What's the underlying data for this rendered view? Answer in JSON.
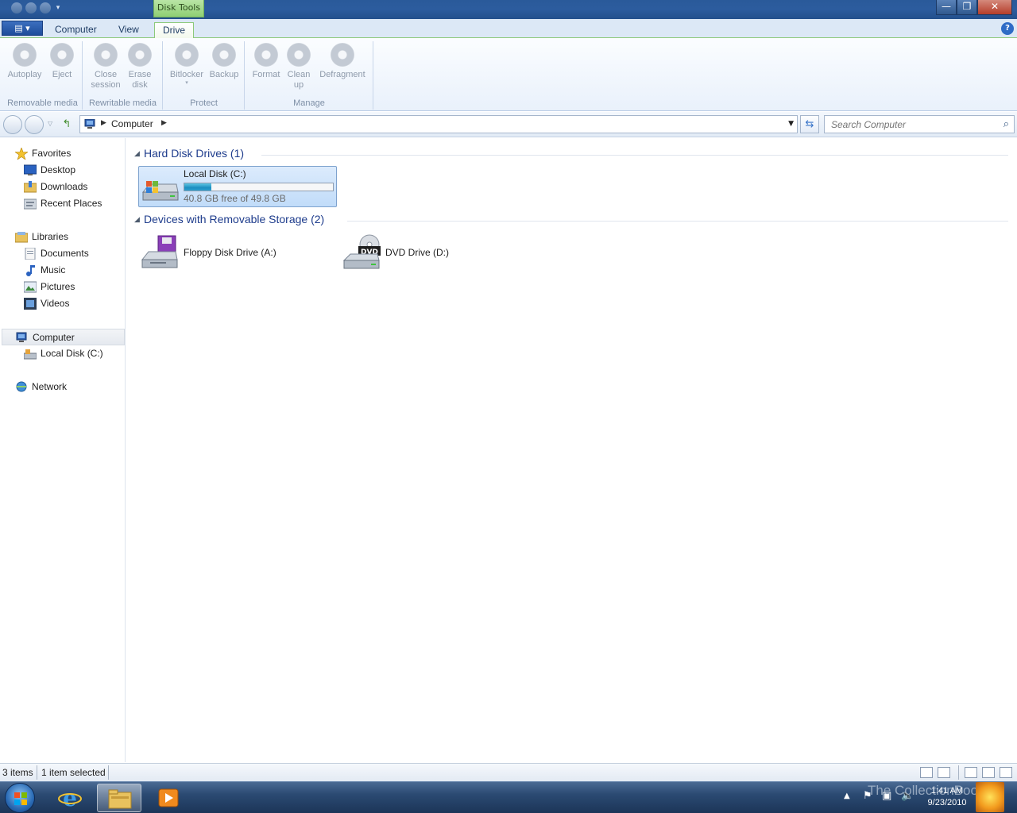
{
  "window": {
    "context_tab": "Disk Tools",
    "minimize": "—",
    "maximize": "❐",
    "close": "✕"
  },
  "ribbon": {
    "tabs": [
      {
        "label": "Computer"
      },
      {
        "label": "View"
      },
      {
        "label": "Drive"
      }
    ],
    "active_tab": "Drive",
    "help": "?",
    "groups": [
      {
        "label": "Removable media",
        "buttons": [
          {
            "label": "Autoplay"
          },
          {
            "label": "Eject"
          }
        ]
      },
      {
        "label": "Rewritable media",
        "buttons": [
          {
            "label": "Close\nsession"
          },
          {
            "label": "Erase\ndisk"
          }
        ]
      },
      {
        "label": "Protect",
        "buttons": [
          {
            "label": "Bitlocker"
          },
          {
            "label": "Backup"
          }
        ]
      },
      {
        "label": "Manage",
        "buttons": [
          {
            "label": "Format"
          },
          {
            "label": "Clean\nup"
          },
          {
            "label": "Defragment"
          }
        ]
      }
    ]
  },
  "address": {
    "crumb": "Computer",
    "search_placeholder": "Search Computer"
  },
  "navpane": {
    "favorites": "Favorites",
    "desktop": "Desktop",
    "downloads": "Downloads",
    "recent": "Recent Places",
    "libraries": "Libraries",
    "documents": "Documents",
    "music": "Music",
    "pictures": "Pictures",
    "videos": "Videos",
    "computer": "Computer",
    "localdisk": "Local Disk (C:)",
    "network": "Network"
  },
  "content": {
    "group_hdd": "Hard Disk Drives (1)",
    "group_removable": "Devices with Removable Storage (2)",
    "local_disk": {
      "name": "Local Disk (C:)",
      "free": "40.8 GB free of 49.8 GB",
      "used_fraction": 0.18
    },
    "floppy": {
      "name": "Floppy Disk Drive (A:)"
    },
    "dvd": {
      "name": "DVD Drive (D:)",
      "badge": "DVD"
    }
  },
  "status": {
    "items": "3 items",
    "selected": "1 item selected"
  },
  "taskbar": {
    "time": "1:41 AM",
    "date": "9/23/2010",
    "watermark": "The CollectionBook"
  },
  "colors": {
    "accent": "#1e3c8c",
    "selection": "#c1dcf9",
    "context_tab": "#8fcf74"
  }
}
